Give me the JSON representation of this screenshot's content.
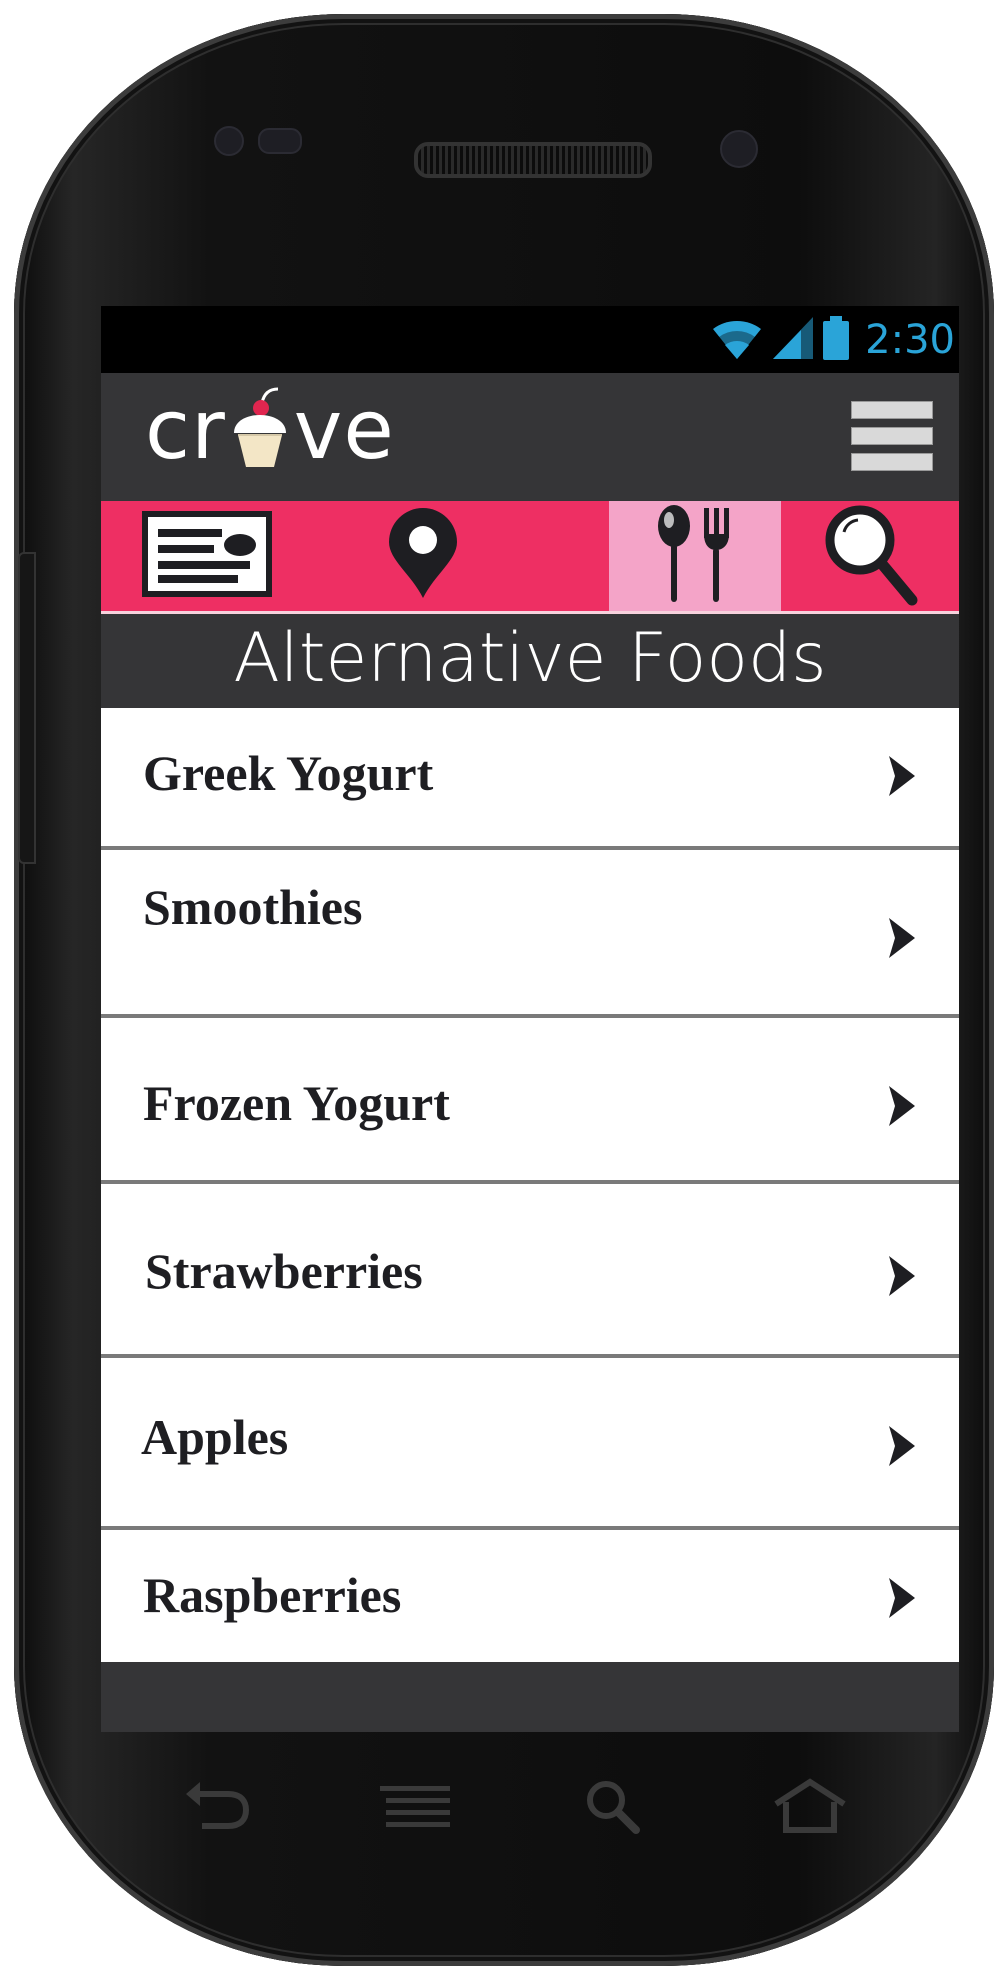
{
  "status_bar": {
    "time": "2:30",
    "icons": [
      "wifi-icon",
      "signal-icon",
      "battery-icon"
    ],
    "icon_color": "#2aa4d8"
  },
  "app_bar": {
    "logo_text_left": "cr",
    "logo_text_right": "ve",
    "logo_icon": "cupcake-icon",
    "menu_icon": "menu-icon"
  },
  "tabs": [
    {
      "icon": "news-card-icon",
      "active": false
    },
    {
      "icon": "location-pin-icon",
      "active": false
    },
    {
      "icon": "spoon-fork-icon",
      "active": true
    },
    {
      "icon": "search-icon",
      "active": false
    }
  ],
  "colors": {
    "tab_bar": "#ee2f63",
    "tab_active": "#f4a4c8",
    "header_bg": "#353537",
    "item_text": "#1e1e22"
  },
  "section_title": "Alternative Foods",
  "list": {
    "items": [
      {
        "label": "Greek Yogurt"
      },
      {
        "label": "Smoothies"
      },
      {
        "label": "Frozen Yogurt"
      },
      {
        "label": "Strawberries"
      },
      {
        "label": "Apples"
      },
      {
        "label": "Raspberries"
      }
    ]
  },
  "nav_keys": [
    "back-icon",
    "recent-apps-icon",
    "search-key-icon",
    "home-icon"
  ]
}
